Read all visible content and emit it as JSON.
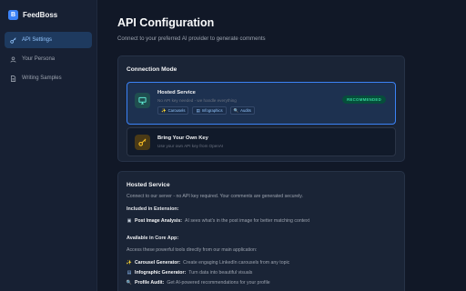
{
  "app": {
    "name": "FeedBoss",
    "logo_letter": "B"
  },
  "sidebar": {
    "items": [
      {
        "label": "API Settings",
        "icon": "key-icon",
        "active": true
      },
      {
        "label": "Your Persona",
        "icon": "user-icon",
        "active": false
      },
      {
        "label": "Writing Samples",
        "icon": "document-icon",
        "active": false
      }
    ]
  },
  "page": {
    "title": "API Configuration",
    "subtitle": "Connect to your preferred AI provider to generate comments"
  },
  "connection_mode": {
    "title": "Connection Mode",
    "hosted": {
      "title": "Hosted Service",
      "subtitle": "No API key needed - we handle everything",
      "badge": "RECOMMENDED",
      "chips": [
        {
          "glyph": "✨",
          "label": "Carousels"
        },
        {
          "glyph": "▤",
          "label": "Infographics"
        },
        {
          "glyph": "🔍",
          "label": "Audits"
        }
      ]
    },
    "byok": {
      "title": "Bring Your Own Key",
      "subtitle": "Use your own API key from OpenAI"
    }
  },
  "hosted_service": {
    "title": "Hosted Service",
    "description": "Connect to our server - no API key required. Your comments are generated securely.",
    "included_heading": "Included in Extension:",
    "included": [
      {
        "glyph": "▣",
        "name": "Post Image Analysis:",
        "desc": "AI sees what's in the post image for better matching context"
      }
    ],
    "core_heading": "Available in Core App:",
    "core_description": "Access these powerful tools directly from our main application:",
    "core": [
      {
        "glyph": "✨",
        "name": "Carousel Generator:",
        "desc": "Create engaging LinkedIn carousels from any topic"
      },
      {
        "glyph": "▤",
        "name": "Infographic Generator:",
        "desc": "Turn data into beautiful visuals"
      },
      {
        "glyph": "🔍",
        "name": "Profile Audit:",
        "desc": "Get AI-powered recommendations for your profile"
      }
    ]
  },
  "colors": {
    "background": "#111827",
    "accent": "#3b82f6",
    "recommended": "#34d399",
    "card": "#1a2436"
  }
}
